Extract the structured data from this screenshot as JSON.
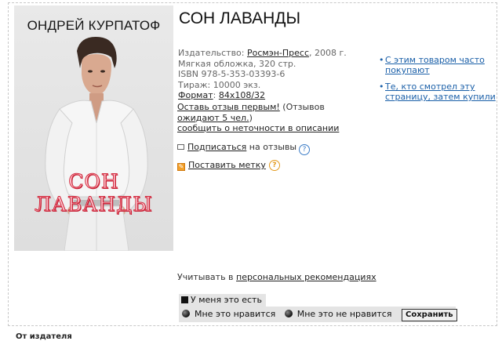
{
  "cover": {
    "author": "ОНДРЕЙ КУРПАТОФ",
    "title": "СОН ЛАВАНДЫ"
  },
  "book": {
    "title": "СОН ЛАВАНДЫ"
  },
  "meta": {
    "publisher_label": "Издательство: ",
    "publisher": "Росмэн-Пресс",
    "publisher_year": ", 2008 г.",
    "binding": "Мягкая обложка, 320 стр.",
    "isbn": "ISBN   978-5-353-03393-6",
    "print_run": "Тираж: 10000 экз.",
    "format_label": "Формат",
    "format_value": "84x108/32"
  },
  "review": {
    "leave_review": "Оставь отзыв первым!",
    "waiting_prefix": " (Отзывов ",
    "waiting_link": "ожидают 5 чел.",
    "waiting_suffix": ")",
    "report_error": "сообщить о неточности в описании"
  },
  "side_links": [
    {
      "bullet": "•",
      "label": "С этим товаром часто покупают"
    },
    {
      "bullet": "•",
      "label": "Те, кто смотрел эту страницу, затем купили"
    }
  ],
  "subscribe": {
    "link": "Подписаться",
    "suffix": " на отзывы",
    "help": "?"
  },
  "tag": {
    "link": "Поставить метку",
    "help": "?"
  },
  "recommendations": {
    "prefix": "Учитывать в ",
    "link": "персональных рекомендациях"
  },
  "ownership": {
    "have_it": "У меня это есть"
  },
  "rating": {
    "like": "Мне это нравится",
    "dislike": "Мне это не нравится",
    "save": "Сохранить"
  },
  "footer": {
    "label": "От издателя"
  },
  "colors": {
    "link_blue": "#1a5fa8",
    "cover_title_red": "#d22a3e",
    "panel_gray": "#e4e4e4"
  }
}
